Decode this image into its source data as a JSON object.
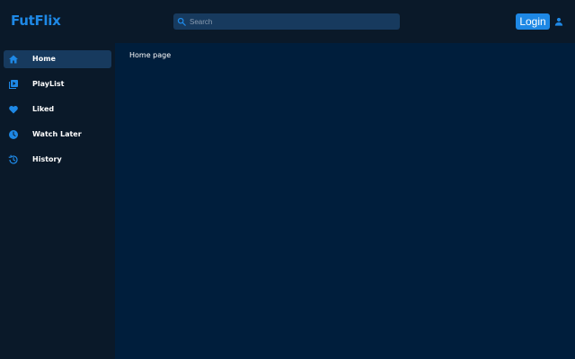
{
  "app": {
    "logo": "FutFlix"
  },
  "header": {
    "search": {
      "placeholder": "Search",
      "value": ""
    },
    "login_label": "Login"
  },
  "sidebar": {
    "items": [
      {
        "label": "Home",
        "icon": "home-icon",
        "active": true
      },
      {
        "label": "PlayList",
        "icon": "playlist-icon",
        "active": false
      },
      {
        "label": "Liked",
        "icon": "heart-icon",
        "active": false
      },
      {
        "label": "Watch Later",
        "icon": "clock-icon",
        "active": false
      },
      {
        "label": "History",
        "icon": "history-icon",
        "active": false
      }
    ]
  },
  "main": {
    "title": "Home page"
  },
  "colors": {
    "accent": "#1e88e5",
    "background": "#0a1929",
    "content_background": "#001e3c",
    "active_item": "#173a5e"
  }
}
